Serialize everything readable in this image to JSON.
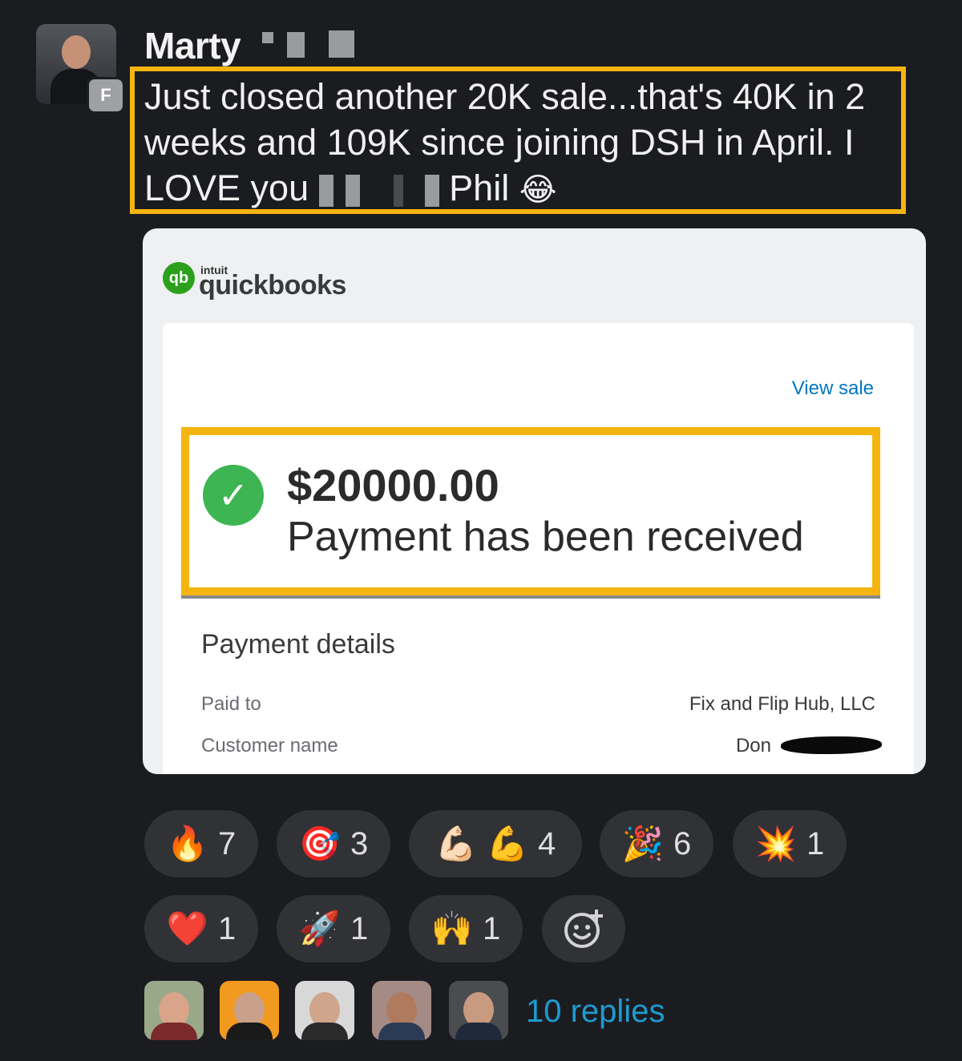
{
  "message": {
    "author": "Marty",
    "author_badge": "F",
    "text": "Just closed another 20K sale...that's 40K in 2 weeks and 109K since joining DSH in April. I LOVE you",
    "text_tail": "Phil",
    "tail_emoji": "😂"
  },
  "attachment": {
    "brand_small": "intuit",
    "brand": "quickbooks",
    "view_sale": "View sale",
    "amount": "$20000.00",
    "status": "Payment has been received",
    "details_title": "Payment details",
    "paid_to_label": "Paid to",
    "paid_to_value": "Fix and Flip Hub, LLC",
    "customer_label": "Customer name",
    "customer_value": "Don"
  },
  "reactions": [
    {
      "emoji": "🔥",
      "count": "7"
    },
    {
      "emoji": "🎯",
      "count": "3"
    },
    {
      "emoji": "💪🏻 💪",
      "count": "4"
    },
    {
      "emoji": "🎉",
      "count": "6"
    },
    {
      "emoji": "💥",
      "count": "1"
    },
    {
      "emoji": "❤️",
      "count": "1"
    },
    {
      "emoji": "🚀",
      "count": "1"
    },
    {
      "emoji": "🙌",
      "count": "1"
    }
  ],
  "replies": "10 replies",
  "icons": {
    "add_reaction": "add-reaction-icon",
    "check": "check-circle-icon"
  },
  "colors": {
    "highlight": "#f5b40f",
    "link": "#1d9bd1",
    "success": "#3cb552"
  }
}
